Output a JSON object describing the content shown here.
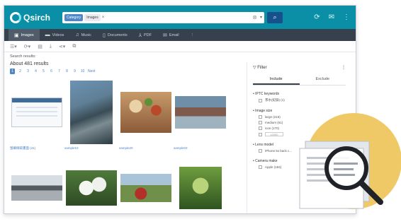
{
  "app": {
    "name": "Qsirch"
  },
  "search": {
    "category_tag": "Category",
    "keyword_tag": "Images",
    "remove_glyph": "×"
  },
  "header_icons": [
    "refresh-icon",
    "mail-icon",
    "more-icon"
  ],
  "type_tabs": [
    {
      "label": "Images",
      "icon": "image-icon",
      "active": true
    },
    {
      "label": "Videos",
      "icon": "video-icon",
      "active": false
    },
    {
      "label": "Music",
      "icon": "music-icon",
      "active": false
    },
    {
      "label": "Documents",
      "icon": "document-icon",
      "active": false
    },
    {
      "label": "PDF",
      "icon": "pdf-icon",
      "active": false
    },
    {
      "label": "Email",
      "icon": "email-icon",
      "active": false
    }
  ],
  "results": {
    "label": "Search results:",
    "count_text": "About 481 results",
    "pages": [
      "1",
      "2",
      "3",
      "4",
      "5",
      "6",
      "7",
      "8",
      "9",
      "10"
    ],
    "next_label": "Next",
    "items": [
      {
        "caption": "螢幕擷取畫面 (41)"
      },
      {
        "caption": "sample10"
      },
      {
        "caption": "sample20"
      },
      {
        "caption": "sample03"
      },
      {
        "caption": ""
      },
      {
        "caption": ""
      },
      {
        "caption": ""
      },
      {
        "caption": ""
      }
    ]
  },
  "filter": {
    "title": "Filter",
    "tabs": [
      "Include",
      "Exclude"
    ],
    "sections": [
      {
        "title": "IPTC keywords",
        "items": [
          "茶水(紀錄) (1)"
        ]
      },
      {
        "title": "Image size",
        "items": [
          "large (216)",
          "medium (61)",
          "icon (170)"
        ],
        "range_placeholder": "x2000"
      },
      {
        "title": "Lens model",
        "items": [
          "iPhone 5s back c..."
        ]
      },
      {
        "title": "Camera make",
        "items": [
          "Apple (184)"
        ]
      }
    ]
  },
  "colors": {
    "header": "#0b8fa6",
    "tabbar": "#36414d",
    "accent": "#4f86c6",
    "deco_circle": "#efc965"
  }
}
